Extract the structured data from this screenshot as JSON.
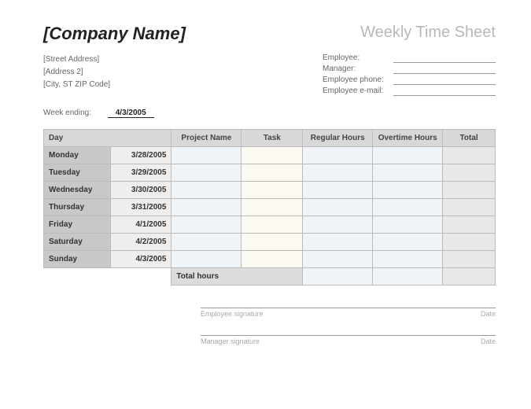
{
  "header": {
    "company": "[Company Name]",
    "title": "Weekly Time Sheet"
  },
  "address": {
    "line1": "[Street Address]",
    "line2": "[Address 2]",
    "line3": "[City, ST  ZIP Code]"
  },
  "employee_fields": {
    "employee": "Employee:",
    "manager": "Manager:",
    "phone": "Employee phone:",
    "email": "Employee e-mail:"
  },
  "week_ending": {
    "label": "Week ending:",
    "value": "4/3/2005"
  },
  "columns": {
    "day": "Day",
    "project": "Project Name",
    "task": "Task",
    "regular": "Regular Hours",
    "overtime": "Overtime Hours",
    "total": "Total"
  },
  "rows": [
    {
      "day": "Monday",
      "date": "3/28/2005"
    },
    {
      "day": "Tuesday",
      "date": "3/29/2005"
    },
    {
      "day": "Wednesday",
      "date": "3/30/2005"
    },
    {
      "day": "Thursday",
      "date": "3/31/2005"
    },
    {
      "day": "Friday",
      "date": "4/1/2005"
    },
    {
      "day": "Saturday",
      "date": "4/2/2005"
    },
    {
      "day": "Sunday",
      "date": "4/3/2005"
    }
  ],
  "total_hours_label": "Total hours",
  "signatures": {
    "emp": "Employee signature",
    "mgr": "Manager signature",
    "date": "Date"
  }
}
